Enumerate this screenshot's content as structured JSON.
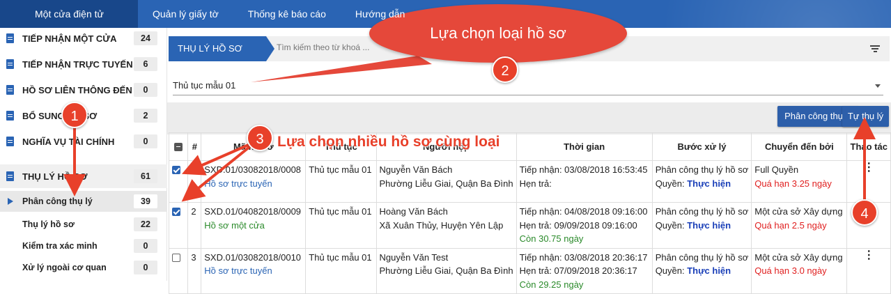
{
  "topnav": {
    "items": [
      "Một cửa điện tử",
      "Quản lý giấy tờ",
      "Thống kê báo cáo",
      "Hướng dẫn"
    ]
  },
  "sidebar": {
    "items": [
      {
        "label": "TIẾP NHẬN MỘT CỬA",
        "count": "24"
      },
      {
        "label": "TIẾP NHẬN TRỰC TUYẾN",
        "count": "6"
      },
      {
        "label": "HỒ SƠ LIÊN THÔNG ĐẾN",
        "count": "0"
      },
      {
        "label": "BỔ SUNG HỒ SƠ",
        "count": "2"
      },
      {
        "label": "NGHĨA VỤ TÀI CHÍNH",
        "count": "0"
      },
      {
        "label": "THỤ LÝ HỒ SƠ",
        "count": "61"
      }
    ],
    "sub_items": [
      {
        "label": "Phân công thụ lý",
        "count": "39"
      },
      {
        "label": "Thụ lý hồ sơ",
        "count": "22"
      },
      {
        "label": "Kiểm tra xác minh",
        "count": "0"
      },
      {
        "label": "Xử lý ngoài cơ quan",
        "count": "0"
      }
    ]
  },
  "main": {
    "breadcrumb": "THỤ LÝ HỒ SƠ",
    "search_placeholder": "Tìm kiếm theo từ khoá ...",
    "procedure_select": "Thủ tục mẫu 01",
    "buttons": {
      "assign": "Phân công thụ lý",
      "self": "Tự thụ lý"
    }
  },
  "table": {
    "headers": [
      "#",
      "Mã hồ sơ",
      "Thủ tục",
      "Người nộp",
      "Thời gian",
      "Bước xử lý",
      "Chuyển đến bởi",
      "Thao tác"
    ],
    "rows": [
      {
        "index": "1",
        "checked": true,
        "code": "SXD.01/03082018/0008",
        "source": "Hồ sơ trực tuyến",
        "procedure": "Thủ tục mẫu 01",
        "name": "Nguyễn Văn Bách",
        "address": "Phường Liễu Giai, Quận Ba Đình",
        "received": "Tiếp nhận: 03/08/2018 16:53:45",
        "due": "Hẹn trả:",
        "remaining": "",
        "step": "Phân công thụ lý hồ sơ",
        "perm_label": "Quyền:",
        "perm": "Thực hiện",
        "from": "Full Quyền",
        "overdue": "Quá hạn 3.25 ngày"
      },
      {
        "index": "2",
        "checked": true,
        "code": "SXD.01/04082018/0009",
        "source": "Hồ sơ một cửa",
        "procedure": "Thủ tục mẫu 01",
        "name": "Hoàng Văn Bách",
        "address": "Xã Xuân Thủy, Huyện Yên Lập",
        "received": "Tiếp nhận: 04/08/2018 09:16:00",
        "due": "Hẹn trả: 09/09/2018 09:16:00",
        "remaining": "Còn 30.75 ngày",
        "step": "Phân công thụ lý hồ sơ",
        "perm_label": "Quyền:",
        "perm": "Thực hiện",
        "from": "Một cửa sở Xây dựng",
        "overdue": "Quá hạn 2.5 ngày"
      },
      {
        "index": "3",
        "checked": false,
        "code": "SXD.01/03082018/0010",
        "source": "Hồ sơ trực tuyến",
        "procedure": "Thủ tục mẫu 01",
        "name": "Nguyễn Văn Test",
        "address": "Phường Liễu Giai, Quận Ba Đình",
        "received": "Tiếp nhận: 03/08/2018 20:36:17",
        "due": "Hẹn trả: 07/09/2018 20:36:17",
        "remaining": "Còn 29.25 ngày",
        "step": "Phân công thụ lý hồ sơ",
        "perm_label": "Quyền:",
        "perm": "Thực hiện",
        "from": "Một cửa sở Xây dựng",
        "overdue": "Quá hạn 3.0 ngày"
      }
    ]
  },
  "annotations": {
    "bubble": "Lựa chọn loại hồ sơ",
    "multi_select": "Lựa chọn nhiều hồ sơ cùng loại",
    "steps": [
      "1",
      "2",
      "3",
      "4"
    ]
  },
  "colors": {
    "primary": "#2a64b4",
    "annotation": "#e8402a",
    "overdue": "#e02020",
    "remaining": "#2a8a2a"
  }
}
